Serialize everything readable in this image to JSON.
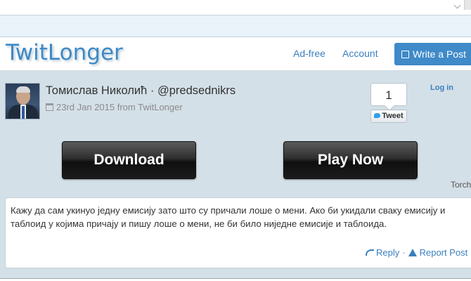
{
  "navbar": {
    "brand": "TwitLonger",
    "ad_free": "Ad-free",
    "account": "Account",
    "write_post": "Write a Post"
  },
  "post": {
    "author": "Томислав Николић · @predsednikrs",
    "date": "23rd Jan 2015 from TwitLonger",
    "tweet_count": "1",
    "tweet_label": "Tweet",
    "login": "Log in",
    "text": "Кажу да сам укинуо једну емисију зато што су причали лоше о мени. Ако би укидали сваку емисију и таблоид у којима причају и пишу лоше о мени, не би било ниједне емисије и таблоида.",
    "reply": "Reply",
    "separator": "·",
    "report": "Report Post"
  },
  "ads": {
    "download": "Download",
    "play_now": "Play Now",
    "torch": "Torch"
  },
  "colors": {
    "brand": "#3e8ac6",
    "link": "#3a7fbf",
    "background": "#d4e0e8",
    "write_button": "#3f8ac8"
  },
  "icons": [
    "edit-icon",
    "calendar-icon",
    "twitter-bird-icon",
    "reply-icon",
    "warning-icon"
  ]
}
